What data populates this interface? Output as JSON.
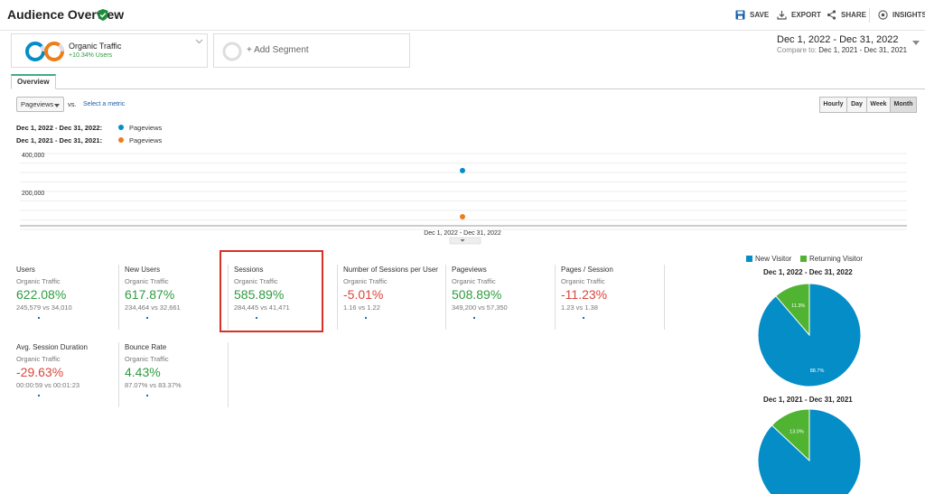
{
  "header": {
    "title": "Audience Overview",
    "save": "SAVE",
    "export": "EXPORT",
    "share": "SHARE",
    "insights": "INSIGHTS"
  },
  "segments": {
    "organic": {
      "name": "Organic Traffic",
      "sub": "+10.34% Users"
    },
    "add": "+ Add Segment"
  },
  "date_range": {
    "primary": "Dec 1, 2022 - Dec 31, 2022",
    "compare_prefix": "Compare to:",
    "compare": "Dec 1, 2021 - Dec 31, 2021"
  },
  "tabs": {
    "overview": "Overview"
  },
  "chart_controls": {
    "metric": "Pageviews",
    "vs": "vs.",
    "select_metric": "Select a metric",
    "granularity": [
      "Hourly",
      "Day",
      "Week",
      "Month"
    ],
    "active_granularity": "Month"
  },
  "colors": {
    "current": "#058dc7",
    "previous": "#ed7e17",
    "positive": "#2e9b41",
    "negative": "#d9453b",
    "new_visitor": "#058dc7",
    "returning_visitor": "#50b432"
  },
  "chart_data": {
    "type": "scatter",
    "legend": [
      {
        "range": "Dec 1, 2022 - Dec 31, 2022:",
        "metric": "Pageviews"
      },
      {
        "range": "Dec 1, 2021 - Dec 31, 2021:",
        "metric": "Pageviews"
      }
    ],
    "y_ticks": [
      "400,000",
      "200,000"
    ],
    "x_label": "Dec 1, 2022 - Dec 31, 2022",
    "ylim": [
      0,
      480000
    ],
    "series": [
      {
        "name": "Dec 1, 2022 - Dec 31, 2022",
        "values": [
          349200
        ]
      },
      {
        "name": "Dec 1, 2021 - Dec 31, 2021",
        "values": [
          57350
        ]
      }
    ]
  },
  "metrics": [
    {
      "label": "Users",
      "segment": "Organic Traffic",
      "value": "622.08%",
      "sign": "pos",
      "compare": "245,579 vs 34,010"
    },
    {
      "label": "New Users",
      "segment": "Organic Traffic",
      "value": "617.87%",
      "sign": "pos",
      "compare": "234,464 vs 32,661"
    },
    {
      "label": "Sessions",
      "segment": "Organic Traffic",
      "value": "585.89%",
      "sign": "pos",
      "compare": "284,445 vs 41,471"
    },
    {
      "label": "Number of Sessions per User",
      "segment": "Organic Traffic",
      "value": "-5.01%",
      "sign": "neg",
      "compare": "1.16 vs 1.22"
    },
    {
      "label": "Pageviews",
      "segment": "Organic Traffic",
      "value": "508.89%",
      "sign": "pos",
      "compare": "349,200 vs 57,350"
    },
    {
      "label": "Pages / Session",
      "segment": "Organic Traffic",
      "value": "-11.23%",
      "sign": "neg",
      "compare": "1.23 vs 1.38"
    },
    {
      "label": "Avg. Session Duration",
      "segment": "Organic Traffic",
      "value": "-29.63%",
      "sign": "neg",
      "compare": "00:00:59 vs 00:01:23"
    },
    {
      "label": "Bounce Rate",
      "segment": "Organic Traffic",
      "value": "4.43%",
      "sign": "pos",
      "compare": "87.07% vs 83.37%"
    }
  ],
  "pies": {
    "legend": [
      "New Visitor",
      "Returning Visitor"
    ],
    "charts": [
      {
        "title": "Dec 1, 2022 - Dec 31, 2022",
        "new_pct": 88.7,
        "new_label": "88.7%",
        "ret_label": "11.3%"
      },
      {
        "title": "Dec 1, 2021 - Dec 31, 2021",
        "new_pct": 87.0,
        "new_label": "",
        "ret_label": "13.0%"
      }
    ]
  }
}
